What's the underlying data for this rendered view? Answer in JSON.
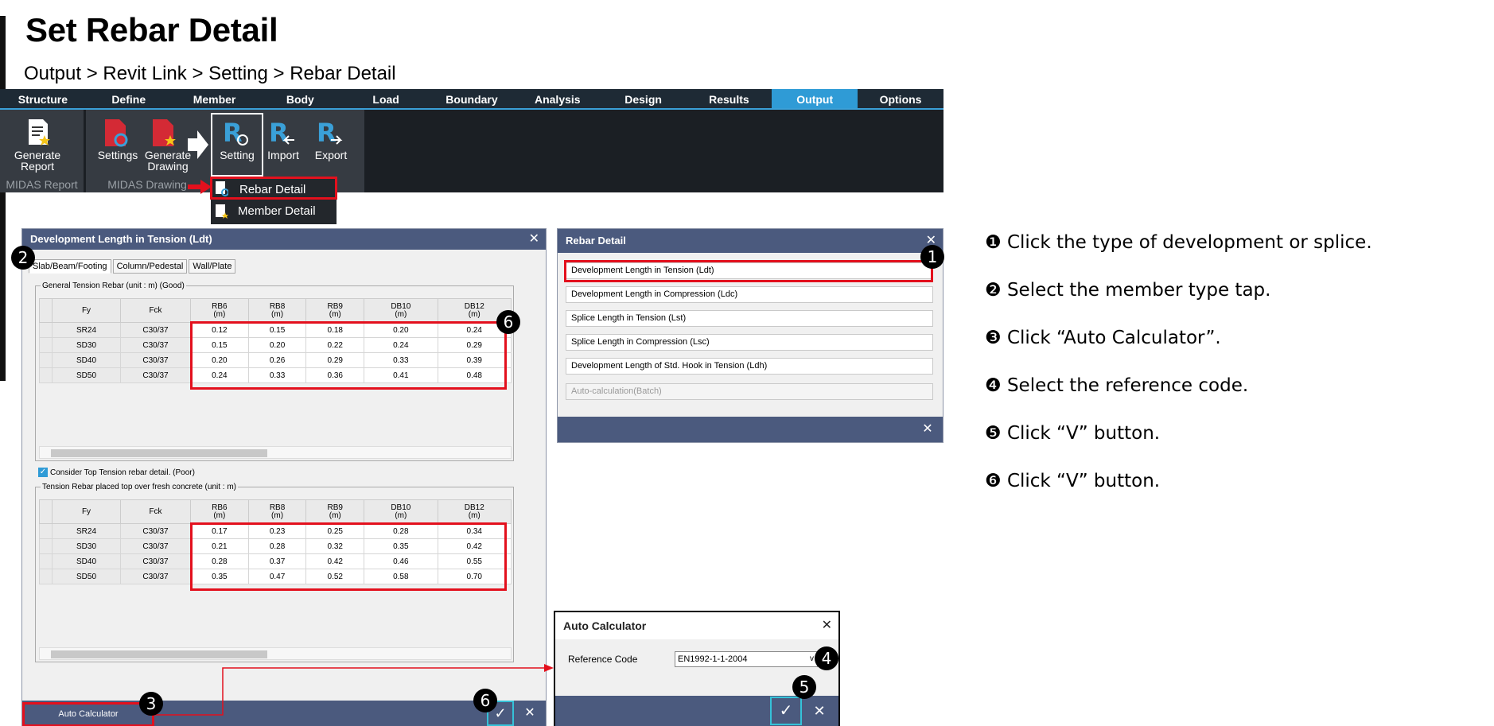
{
  "page": {
    "title": "Set Rebar Detail",
    "breadcrumb": "Output > Revit Link > Setting > Rebar Detail"
  },
  "ribbon": {
    "tabs": [
      "Structure",
      "Define",
      "Member",
      "Body",
      "Load",
      "Boundary",
      "Analysis",
      "Design",
      "Results",
      "Output",
      "Options"
    ],
    "active_tab": "Output",
    "buttons": {
      "generate_report": "Generate\nReport",
      "settings": "Settings",
      "generate_drawing": "Generate\nDrawing",
      "setting": "Setting",
      "import": "Import",
      "export": "Export"
    },
    "groups": {
      "midas_report": "MIDAS Report",
      "midas_drawing": "MIDAS Drawing"
    },
    "dropdown": {
      "rebar_detail": "Rebar Detail",
      "member_detail": "Member Detail"
    }
  },
  "dev_dialog": {
    "title": "Development Length in Tension (Ldt)",
    "tabs": [
      "Slab/Beam/Footing",
      "Column/Pedestal",
      "Wall/Plate"
    ],
    "group1_legend": "General Tension Rebar (unit : m) (Good)",
    "columns": [
      "Fy",
      "Fck",
      "RB6\n(m)",
      "RB8\n(m)",
      "RB9\n(m)",
      "DB10\n(m)",
      "DB12\n(m)"
    ],
    "table1": [
      [
        "SR24",
        "C30/37",
        "0.12",
        "0.15",
        "0.18",
        "0.20",
        "0.24"
      ],
      [
        "SD30",
        "C30/37",
        "0.15",
        "0.20",
        "0.22",
        "0.24",
        "0.29"
      ],
      [
        "SD40",
        "C30/37",
        "0.20",
        "0.26",
        "0.29",
        "0.33",
        "0.39"
      ],
      [
        "SD50",
        "C30/37",
        "0.24",
        "0.33",
        "0.36",
        "0.41",
        "0.48"
      ]
    ],
    "checkbox_label": "Consider Top Tension rebar detail. (Poor)",
    "group2_legend": "Tension Rebar placed top over fresh concrete (unit : m)",
    "table2": [
      [
        "SR24",
        "C30/37",
        "0.17",
        "0.23",
        "0.25",
        "0.28",
        "0.34"
      ],
      [
        "SD30",
        "C30/37",
        "0.21",
        "0.28",
        "0.32",
        "0.35",
        "0.42"
      ],
      [
        "SD40",
        "C30/37",
        "0.28",
        "0.37",
        "0.42",
        "0.46",
        "0.55"
      ],
      [
        "SD50",
        "C30/37",
        "0.35",
        "0.47",
        "0.52",
        "0.58",
        "0.70"
      ]
    ],
    "auto_calc_button": "Auto Calculator"
  },
  "rebar_dialog": {
    "title": "Rebar Detail",
    "items": [
      "Development Length in Tension (Ldt)",
      "Development Length in Compression (Ldc)",
      "Splice Length in Tension (Lst)",
      "Splice Length in Compression (Lsc)",
      "Development Length of Std. Hook in Tension (Ldh)",
      "Auto-calculation(Batch)"
    ]
  },
  "auto_dialog": {
    "title": "Auto Calculator",
    "ref_label": "Reference Code",
    "ref_value": "EN1992-1-1-2004"
  },
  "badges": [
    "1",
    "2",
    "3",
    "4",
    "5",
    "6"
  ],
  "steps": [
    {
      "num": "❶",
      "text": "Click the type of development or splice."
    },
    {
      "num": "❷",
      "text": "Select the member type tap."
    },
    {
      "num": "❸",
      "text": "Click “Auto Calculator”."
    },
    {
      "num": "❹",
      "text": "Select the reference code."
    },
    {
      "num": "❺",
      "text": "Click “V” button."
    },
    {
      "num": "❻",
      "text": "Click “V” button."
    }
  ],
  "colors": {
    "accent": "#2f9bd6",
    "highlight": "#e3101d",
    "dialog_title": "#4b5a7e"
  }
}
